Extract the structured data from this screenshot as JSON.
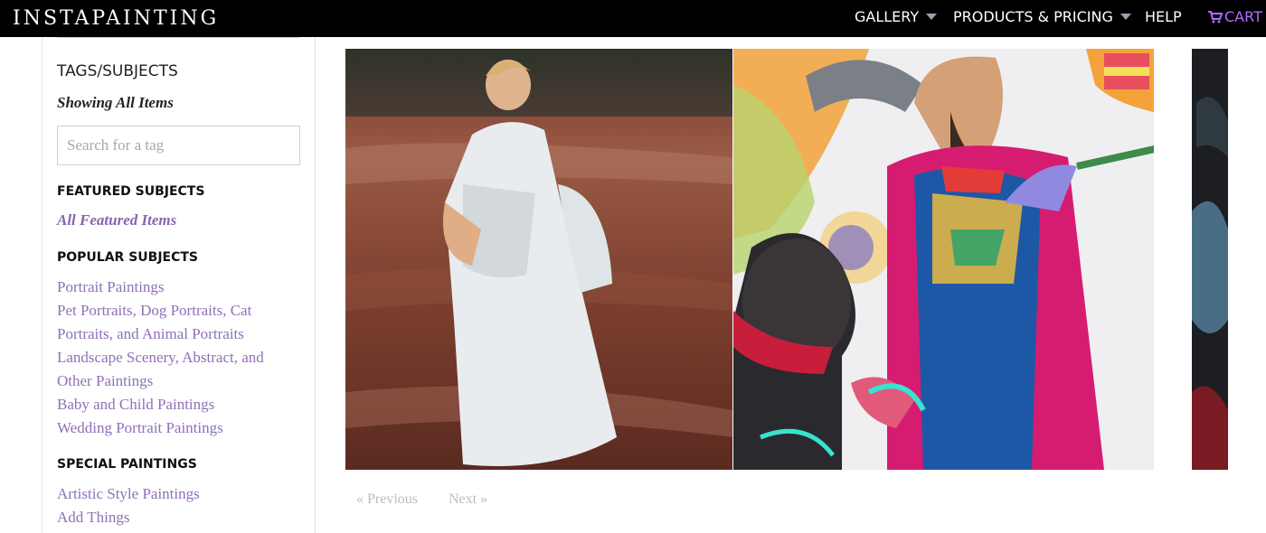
{
  "header": {
    "logo": "INSTAPAINTING",
    "nav": {
      "gallery": "GALLERY",
      "products": "PRODUCTS & PRICING",
      "help": "HELP",
      "cart": "CART"
    }
  },
  "sidebar": {
    "tags_title": "TAGS/SUBJECTS",
    "showing": "Showing All Items",
    "search_placeholder": "Search for a tag",
    "featured_title": "FEATURED SUBJECTS",
    "featured_link": "All Featured Items",
    "popular_title": "POPULAR SUBJECTS",
    "popular": [
      "Portrait Paintings",
      "Pet Portraits, Dog Portraits, Cat Portraits, and Animal Portraits",
      "Landscape Scenery, Abstract, and Other Paintings",
      "Baby and Child Paintings",
      "Wedding Portrait Paintings"
    ],
    "special_title": "SPECIAL PAINTINGS",
    "special": [
      "Artistic Style Paintings",
      "Add Things"
    ]
  },
  "pager": {
    "previous": "« Previous",
    "next": "Next »"
  }
}
